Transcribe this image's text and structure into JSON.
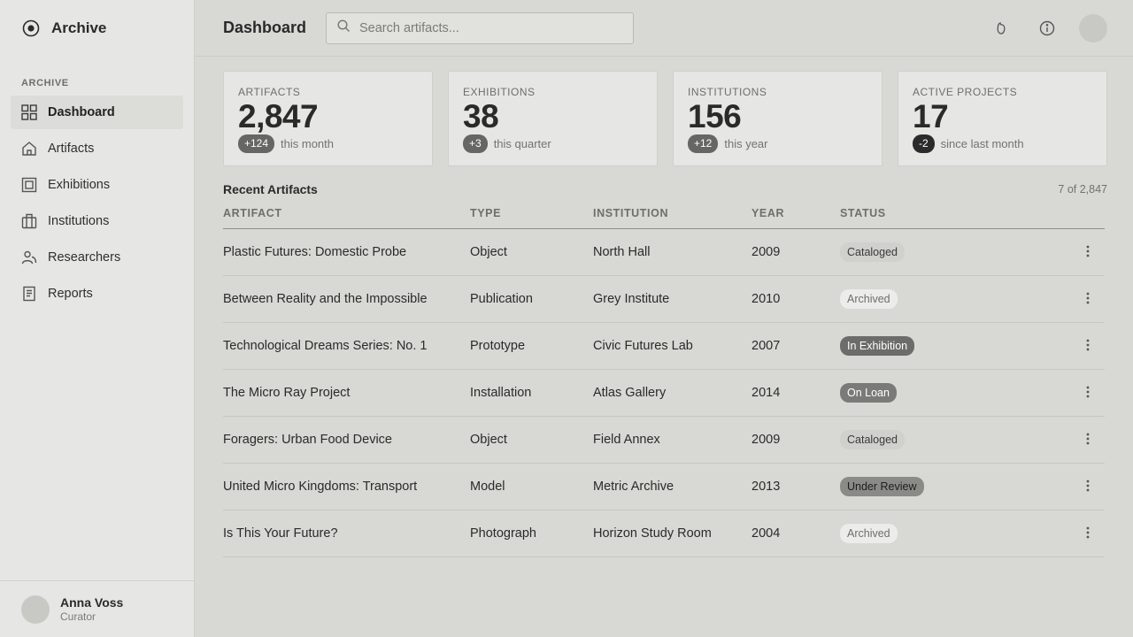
{
  "app": {
    "name": "Archive"
  },
  "sidebar": {
    "section_label": "ARCHIVE",
    "items": [
      {
        "label": "Dashboard",
        "icon": "grid-icon",
        "active": true
      },
      {
        "label": "Artifacts",
        "icon": "home-icon"
      },
      {
        "label": "Exhibitions",
        "icon": "frame-icon"
      },
      {
        "label": "Institutions",
        "icon": "building-icon"
      },
      {
        "label": "Researchers",
        "icon": "users-icon"
      },
      {
        "label": "Reports",
        "icon": "document-icon"
      }
    ],
    "user": {
      "name": "Anna Voss",
      "role": "Curator"
    }
  },
  "header": {
    "title": "Dashboard",
    "search_placeholder": "Search artifacts...",
    "search_value": ""
  },
  "stats": [
    {
      "label": "ARTIFACTS",
      "value": "2,847",
      "delta": "+124",
      "note": "this month"
    },
    {
      "label": "EXHIBITIONS",
      "value": "38",
      "delta": "+3",
      "note": "this quarter"
    },
    {
      "label": "INSTITUTIONS",
      "value": "156",
      "delta": "+12",
      "note": "this year"
    },
    {
      "label": "ACTIVE PROJECTS",
      "value": "17",
      "delta": "-2",
      "note": "since last month"
    }
  ],
  "recent": {
    "title": "Recent Artifacts",
    "count": "7 of 2,847",
    "columns": [
      "ARTIFACT",
      "TYPE",
      "INSTITUTION",
      "YEAR",
      "STATUS"
    ],
    "rows": [
      {
        "artifact": "Plastic Futures: Domestic Probe",
        "type": "Object",
        "institution": "North Hall",
        "year": "2009",
        "status": "Cataloged"
      },
      {
        "artifact": "Between Reality and the Impossible",
        "type": "Publication",
        "institution": "Grey Institute",
        "year": "2010",
        "status": "Archived"
      },
      {
        "artifact": "Technological Dreams Series: No. 1",
        "type": "Prototype",
        "institution": "Civic Futures Lab",
        "year": "2007",
        "status": "In Exhibition"
      },
      {
        "artifact": "The Micro Ray Project",
        "type": "Installation",
        "institution": "Atlas Gallery",
        "year": "2014",
        "status": "On Loan"
      },
      {
        "artifact": "Foragers: Urban Food Device",
        "type": "Object",
        "institution": "Field Annex",
        "year": "2009",
        "status": "Cataloged"
      },
      {
        "artifact": "United Micro Kingdoms: Transport",
        "type": "Model",
        "institution": "Metric Archive",
        "year": "2013",
        "status": "Under Review"
      },
      {
        "artifact": "Is This Your Future?",
        "type": "Photograph",
        "institution": "Horizon Study Room",
        "year": "2004",
        "status": "Archived"
      }
    ]
  }
}
